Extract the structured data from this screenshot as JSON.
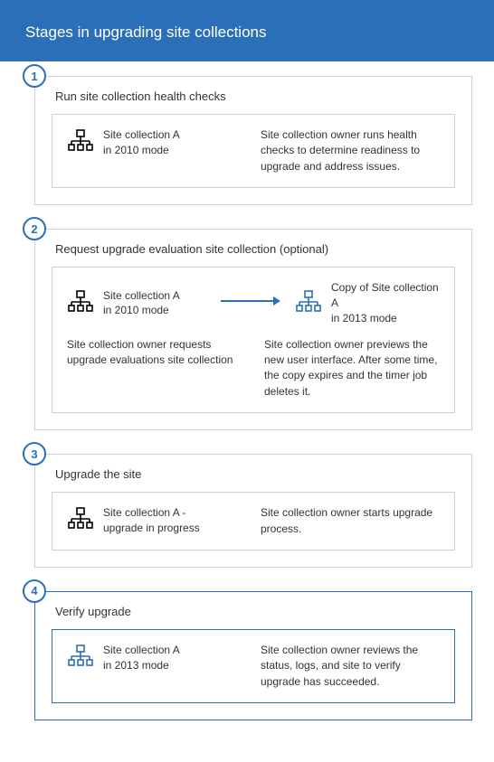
{
  "header": {
    "title": "Stages in upgrading site collections"
  },
  "stages": [
    {
      "num": "1",
      "title": "Run site collection health checks",
      "left_label_line1": "Site collection A",
      "left_label_line2": "in 2010 mode",
      "right_text": "Site collection owner runs health checks to determine readiness to upgrade and address issues."
    },
    {
      "num": "2",
      "title": "Request upgrade evaluation site collection (optional)",
      "left_label_line1": "Site collection A",
      "left_label_line2": "in 2010 mode",
      "copy_label_line1": "Copy of Site collection A",
      "copy_label_line2": "in 2013 mode",
      "left_desc": "Site collection owner requests upgrade evaluations site collection",
      "right_desc": "Site collection owner previews the new user interface. After some time, the copy expires and the timer job deletes it."
    },
    {
      "num": "3",
      "title": "Upgrade the site",
      "left_label_line1": "Site collection A -",
      "left_label_line2": "upgrade in progress",
      "right_text": "Site collection owner starts upgrade process."
    },
    {
      "num": "4",
      "title": "Verify upgrade",
      "left_label_line1": "Site collection A",
      "left_label_line2": "in 2013 mode",
      "right_text": "Site collection owner reviews the status, logs, and site to verify upgrade has succeeded."
    }
  ]
}
